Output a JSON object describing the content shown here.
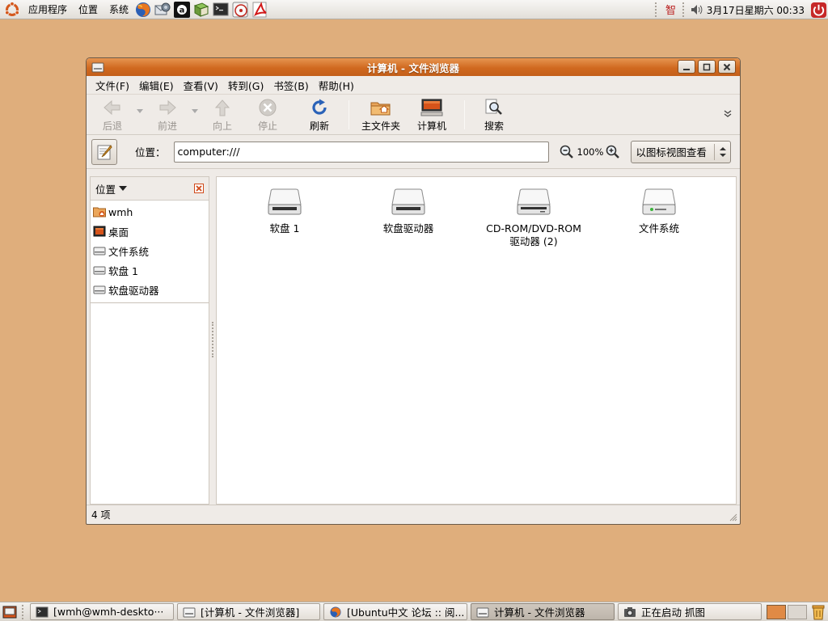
{
  "top_panel": {
    "menus": [
      "应用程序",
      "位置",
      "系统"
    ],
    "launchers": [
      "firefox-icon",
      "evolution-icon",
      "pidgin-icon",
      "books-icon",
      "terminal-icon",
      "cd-player-icon",
      "pdf-reader-icon"
    ],
    "clock": "3月17日星期六 00:33"
  },
  "window": {
    "title": "计算机 - 文件浏览器",
    "menus": [
      "文件(F)",
      "编辑(E)",
      "查看(V)",
      "转到(G)",
      "书签(B)",
      "帮助(H)"
    ],
    "toolbar": {
      "back": "后退",
      "forward": "前进",
      "up": "向上",
      "stop": "停止",
      "reload": "刷新",
      "home": "主文件夹",
      "computer": "计算机",
      "search": "搜索"
    },
    "location": {
      "label": "位置：",
      "value": "computer:///",
      "zoom": "100%",
      "view_mode": "以图标视图查看"
    },
    "sidebar": {
      "title": "位置",
      "places": [
        {
          "label": "wmh",
          "icon": "home-folder-icon"
        },
        {
          "label": "桌面",
          "icon": "desktop-icon"
        },
        {
          "label": "文件系统",
          "icon": "drive-icon"
        },
        {
          "label": "软盘 1",
          "icon": "drive-icon"
        },
        {
          "label": "软盘驱动器",
          "icon": "drive-icon"
        }
      ]
    },
    "items": [
      {
        "label": "软盘 1",
        "icon": "floppy-drive-icon"
      },
      {
        "label": "软盘驱动器",
        "icon": "floppy-drive-icon"
      },
      {
        "label": "CD-ROM/DVD-ROM 驱动器 (2)",
        "icon": "optical-drive-icon"
      },
      {
        "label": "文件系统",
        "icon": "hard-drive-icon"
      }
    ],
    "status": "4 项"
  },
  "taskbar": {
    "tasks": [
      {
        "label": "[wmh@wmh-deskto···",
        "icon": "terminal-icon",
        "active": false
      },
      {
        "label": "[计算机 - 文件浏览器]",
        "icon": "file-manager-icon",
        "active": false
      },
      {
        "label": "[Ubuntu中文 论坛 :: 阅...",
        "icon": "firefox-icon",
        "active": false
      },
      {
        "label": "计算机 - 文件浏览器",
        "icon": "file-manager-icon",
        "active": true
      },
      {
        "label": "正在启动 抓图",
        "icon": "camera-icon",
        "active": false
      }
    ]
  },
  "colors": {
    "desktop": "#dfae7c",
    "titlebar": "#d0691f",
    "accent": "#e08a45"
  }
}
